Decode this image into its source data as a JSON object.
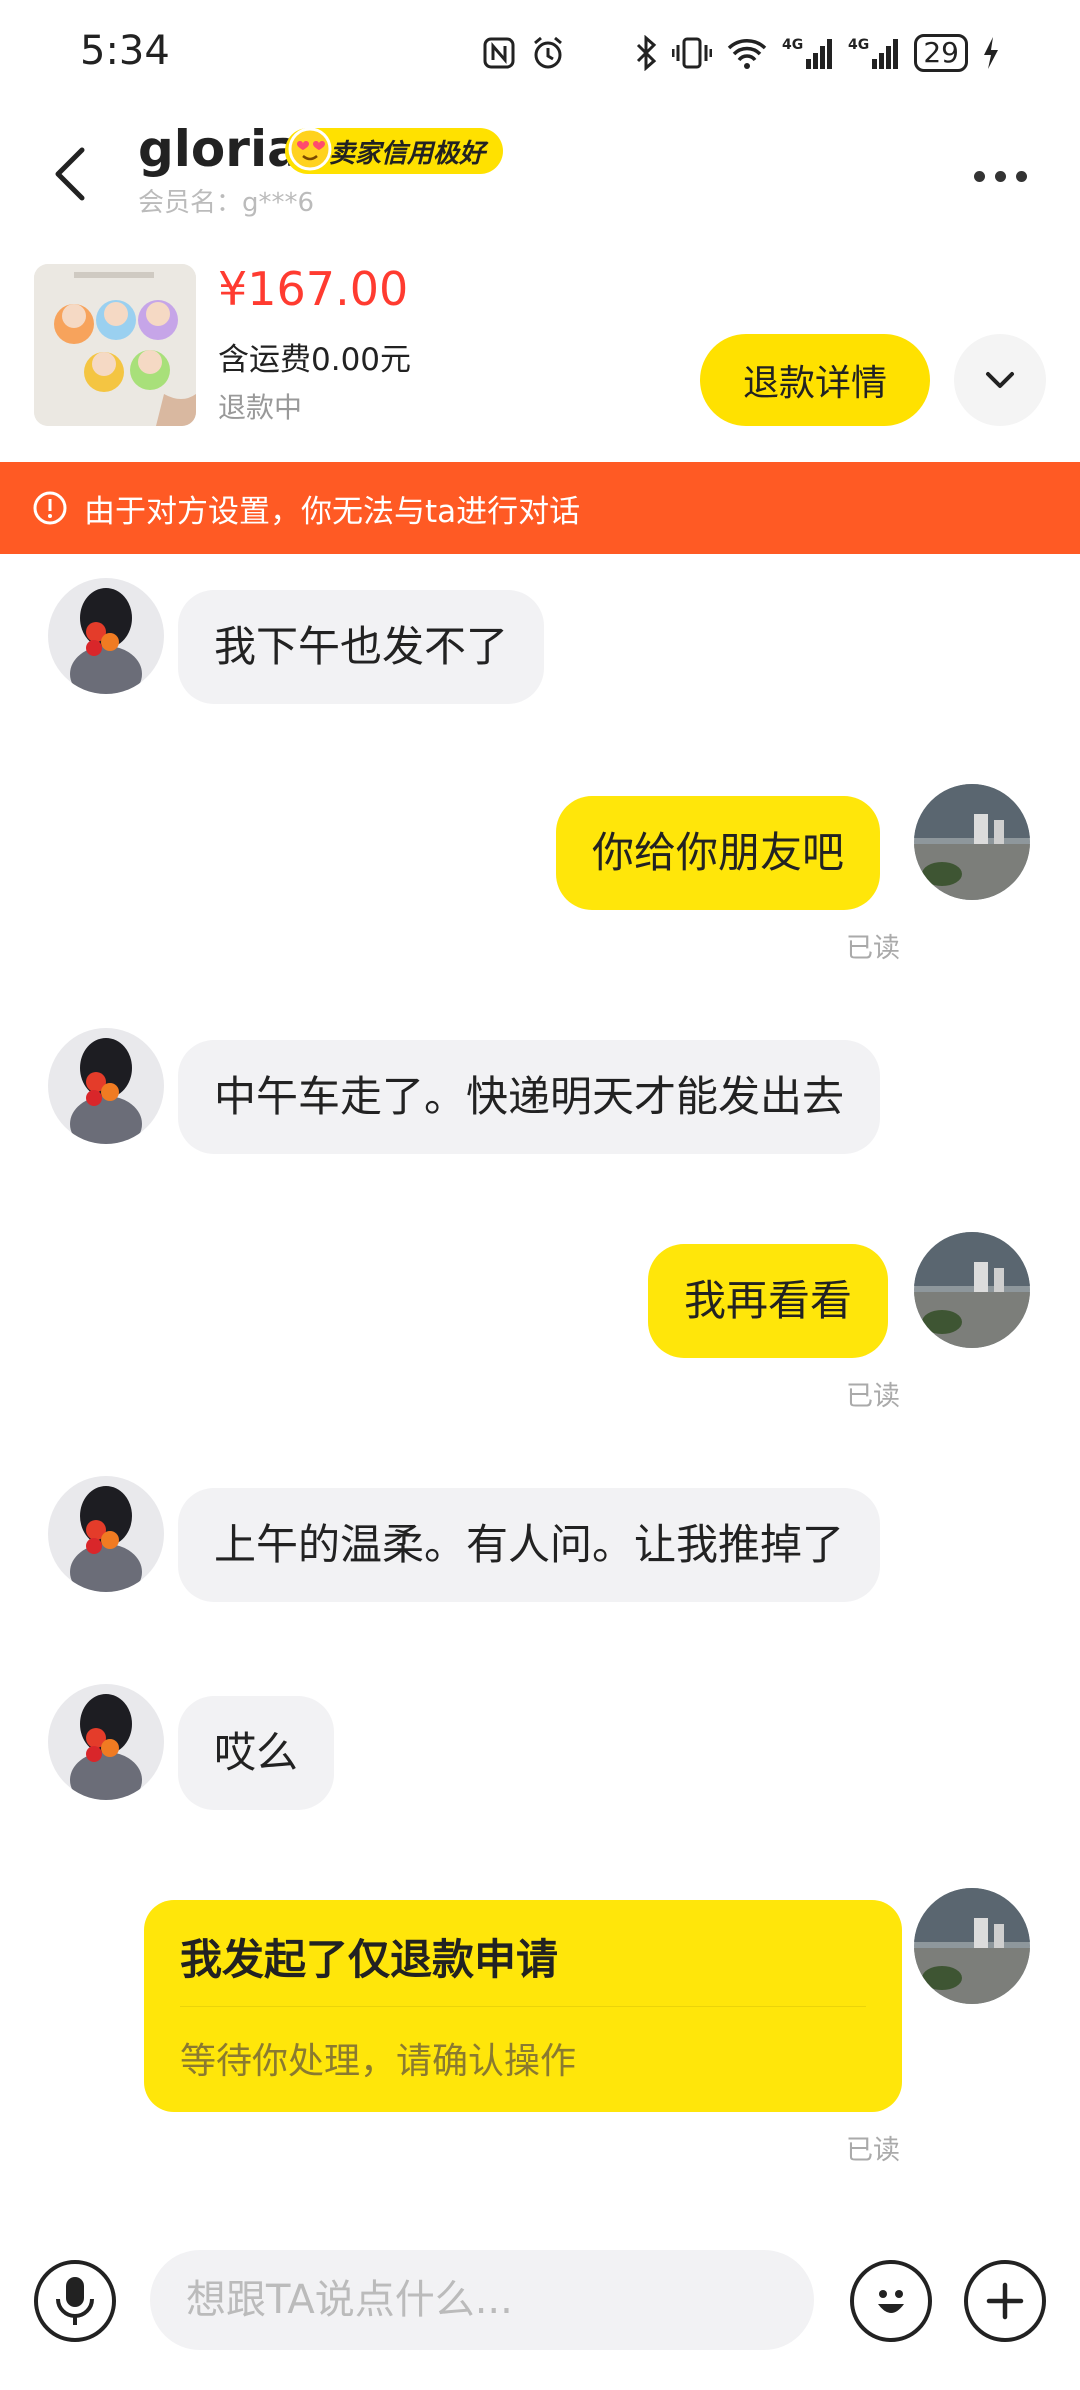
{
  "status_bar": {
    "time": "5:34",
    "battery": "29",
    "icons": [
      "nfc-icon",
      "alarm-icon",
      "bluetooth-icon",
      "vibrate-icon",
      "wifi-icon",
      "signal-4g-icon",
      "signal-4g-icon",
      "battery-icon",
      "charging-icon"
    ]
  },
  "header": {
    "name": "gloria",
    "badge": "卖家信用极好",
    "member_id": "会员名：g***6"
  },
  "product": {
    "price": "¥167.00",
    "shipping": "含运费0.00元",
    "status": "退款中",
    "refund_button": "退款详情"
  },
  "warning": {
    "text": "由于对方设置，你无法与ta进行对话"
  },
  "messages": [
    {
      "side": "in",
      "text": "我下午也发不了"
    },
    {
      "side": "out",
      "text": "你给你朋友吧",
      "read": "已读"
    },
    {
      "side": "in",
      "text": "中午车走了。快递明天才能发出去"
    },
    {
      "side": "out",
      "text": "我再看看",
      "read": "已读"
    },
    {
      "side": "in",
      "text": "上午的温柔。有人问。让我推掉了"
    },
    {
      "side": "in",
      "text": "哎么"
    }
  ],
  "refund_card": {
    "title": "我发起了仅退款申请",
    "subtitle": "等待你处理，请确认操作",
    "read": "已读"
  },
  "input": {
    "placeholder": "想跟TA说点什么..."
  },
  "colors": {
    "accent_yellow": "#ffe100",
    "warning_orange": "#ff5a24",
    "price_red": "#ff3b30",
    "incoming_bubble": "#f2f2f4"
  }
}
